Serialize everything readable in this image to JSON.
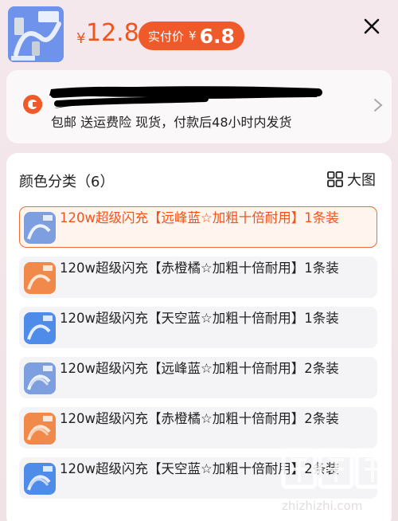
{
  "header": {
    "price_symbol": "¥",
    "price": "12.8",
    "actual_label": "实付价",
    "actual_symbol": "¥",
    "actual_price": "6.8",
    "close_icon": "close-icon"
  },
  "shipping": {
    "icon": "shipping-badge-icon",
    "text": "包邮  送运费险  现货，付款后48小时内发货"
  },
  "variants": {
    "title": "颜色分类（6）",
    "big_picture_label": "大图",
    "options": [
      {
        "text": "120w超级闪充【远峰蓝☆加粗十倍耐用】1条装",
        "color": "#7d9fe0",
        "selected": true
      },
      {
        "text": "120w超级闪充【赤橙橘☆加粗十倍耐用】1条装",
        "color": "#f0894a",
        "selected": false
      },
      {
        "text": "120w超级闪充【天空蓝☆加粗十倍耐用】1条装",
        "color": "#4f8be8",
        "selected": false
      },
      {
        "text": "120w超级闪充【远峰蓝☆加粗十倍耐用】2条装",
        "color": "#7d9fe0",
        "selected": false
      },
      {
        "text": "120w超级闪充【赤橙橘☆加粗十倍耐用】2条装",
        "color": "#f0894a",
        "selected": false
      },
      {
        "text": "120w超级闪充【天空蓝☆加粗十倍耐用】2条装",
        "color": "#4f8be8",
        "selected": false
      }
    ]
  },
  "watermark": {
    "text": "zhizhizhi.com"
  },
  "colors": {
    "accent": "#f05a2a",
    "panel": "#ffffff",
    "background": "#f4e8ec"
  }
}
